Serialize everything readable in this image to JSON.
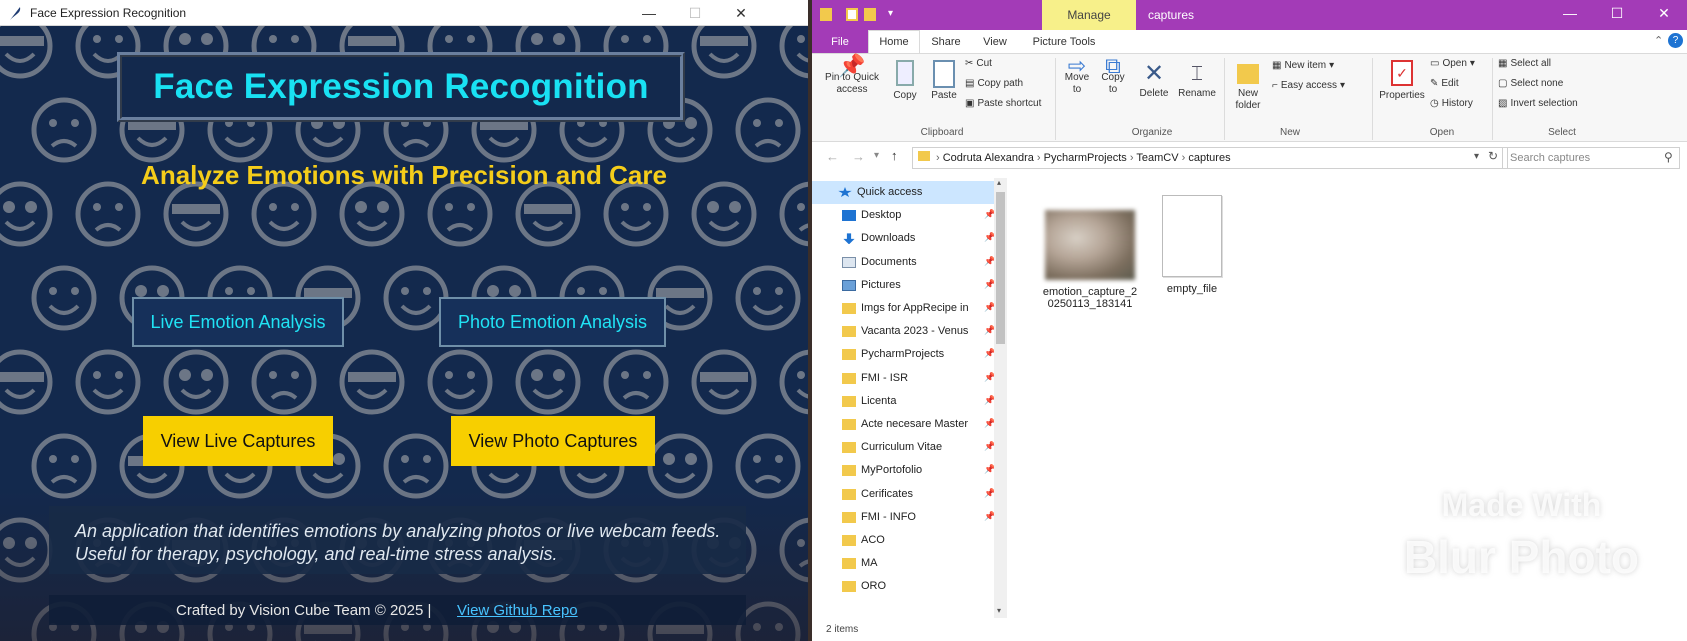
{
  "app_window": {
    "title": "Face Expression Recognition",
    "heading": "Face Expression Recognition",
    "subtitle": "Analyze Emotions with Precision and Care",
    "buttons": {
      "live_analysis": "Live Emotion Analysis",
      "photo_analysis": "Photo Emotion Analysis",
      "live_captures": "View Live Captures",
      "photo_captures": "View Photo Captures"
    },
    "description": "An application that identifies emotions by analyzing photos or live webcam feeds. Useful for therapy, psychology, and real-time stress analysis.",
    "footer": {
      "credit": "Crafted by Vision Cube Team © 2025 |",
      "repo_link": "View Github Repo"
    },
    "colors": {
      "background": "#13294d",
      "title_cyan": "#19e1f3",
      "subtitle_yellow": "#f5cd1a",
      "button_yellow": "#f7cf00",
      "emoji_gray": "#7c8490"
    }
  },
  "explorer": {
    "title": "captures",
    "context_tab": "Manage",
    "tabs": [
      "File",
      "Home",
      "Share",
      "View",
      "Picture Tools"
    ],
    "ribbon": {
      "pin": "Pin to Quick access",
      "copy": "Copy",
      "paste": "Paste",
      "cut": "Cut",
      "copy_path": "Copy path",
      "paste_shortcut": "Paste shortcut",
      "move_to": "Move to",
      "copy_to": "Copy to",
      "delete": "Delete",
      "rename": "Rename",
      "new_folder": "New folder",
      "new_item": "New item",
      "easy_access": "Easy access",
      "properties": "Properties",
      "open": "Open",
      "edit": "Edit",
      "history": "History",
      "select_all": "Select all",
      "select_none": "Select none",
      "invert_selection": "Invert selection",
      "groups": [
        "Clipboard",
        "Organize",
        "New",
        "Open",
        "Select"
      ]
    },
    "breadcrumb": [
      "Codruta Alexandra",
      "PycharmProjects",
      "TeamCV",
      "captures"
    ],
    "search_placeholder": "Search captures",
    "nav": [
      {
        "label": "Quick access",
        "icon": "star-icon",
        "pinned": false
      },
      {
        "label": "Desktop",
        "icon": "desktop-icon",
        "pinned": true
      },
      {
        "label": "Downloads",
        "icon": "download-icon",
        "pinned": true
      },
      {
        "label": "Documents",
        "icon": "document-icon",
        "pinned": true
      },
      {
        "label": "Pictures",
        "icon": "pictures-icon",
        "pinned": true
      },
      {
        "label": "Imgs for AppRecipe in",
        "icon": "folder-icon",
        "pinned": true
      },
      {
        "label": "Vacanta 2023 - Venus",
        "icon": "folder-icon",
        "pinned": true
      },
      {
        "label": "PycharmProjects",
        "icon": "folder-icon",
        "pinned": true
      },
      {
        "label": "FMI - ISR",
        "icon": "folder-icon",
        "pinned": true
      },
      {
        "label": "Licenta",
        "icon": "folder-icon",
        "pinned": true
      },
      {
        "label": "Acte necesare Master",
        "icon": "folder-icon",
        "pinned": true
      },
      {
        "label": "Curriculum Vitae",
        "icon": "folder-icon",
        "pinned": true
      },
      {
        "label": "MyPortofolio",
        "icon": "folder-icon",
        "pinned": true
      },
      {
        "label": "Cerificates",
        "icon": "folder-icon",
        "pinned": true
      },
      {
        "label": "FMI - INFO",
        "icon": "folder-icon",
        "pinned": true
      },
      {
        "label": "ACO",
        "icon": "folder-icon",
        "pinned": false
      },
      {
        "label": "MA",
        "icon": "folder-icon",
        "pinned": false
      },
      {
        "label": "ORO",
        "icon": "folder-icon",
        "pinned": false
      }
    ],
    "files": [
      {
        "name": "emotion_capture_20250113_183141",
        "type": "image-thumbnail"
      },
      {
        "name": "empty_file",
        "type": "blank-document"
      }
    ],
    "status": "2 items",
    "watermark": {
      "line1": "Made With",
      "line2": "Blur Photo"
    },
    "colors": {
      "titlebar": "#a33bb7",
      "manage_tab": "#f7f08a",
      "selected_nav": "#cce6ff",
      "folder": "#f2c94c"
    }
  }
}
